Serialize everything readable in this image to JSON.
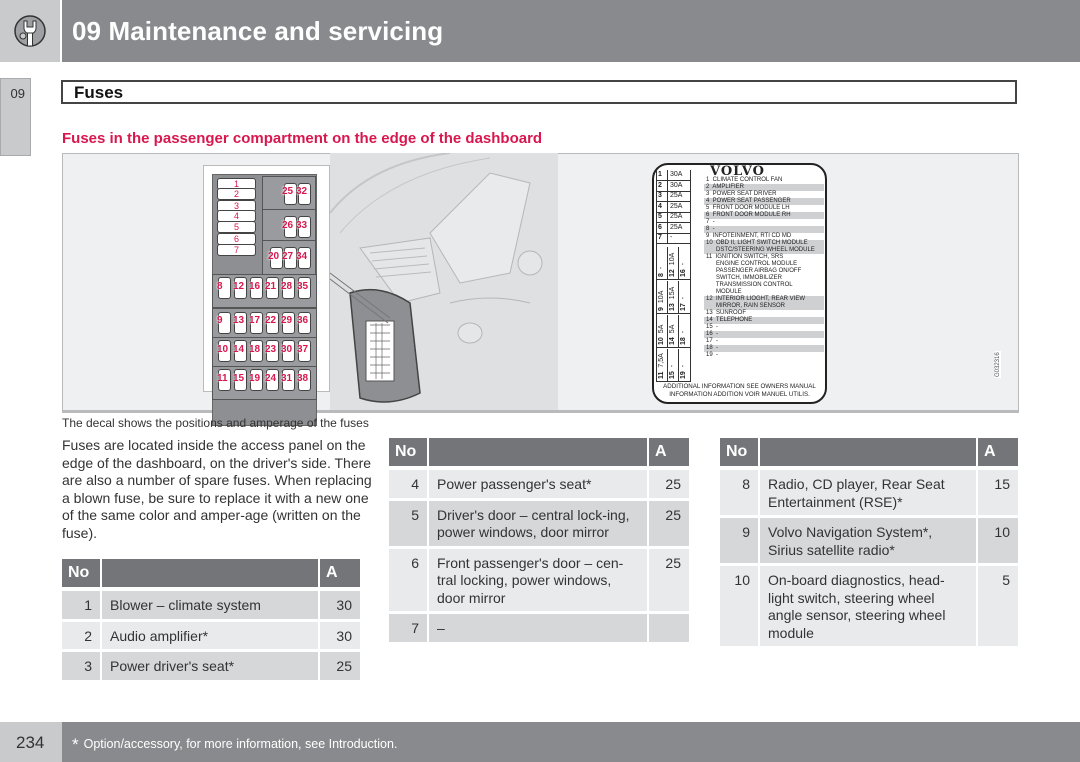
{
  "header": {
    "chapter_title": "09 Maintenance and servicing",
    "icon": "wrench-icon"
  },
  "side_tab": {
    "label": "09"
  },
  "section": {
    "title": "Fuses"
  },
  "subheading": "Fuses in the passenger compartment on the edge of the dashboard",
  "figure": {
    "caption": "The decal shows the positions and amperage of the fuses",
    "code": "G032316",
    "fusebox": {
      "wide_slots": [
        "1",
        "2",
        "3",
        "4",
        "5",
        "6",
        "7"
      ],
      "upper_panels": [
        [
          "25",
          "32"
        ],
        [
          "26",
          "33"
        ],
        [
          "20",
          "27",
          "34"
        ]
      ],
      "rows": [
        [
          "8",
          "12",
          "16",
          "21",
          "28",
          "35"
        ],
        [
          "9",
          "13",
          "17",
          "22",
          "29",
          "36"
        ],
        [
          "10",
          "14",
          "18",
          "23",
          "30",
          "37"
        ],
        [
          "11",
          "15",
          "19",
          "24",
          "31",
          "38"
        ]
      ]
    },
    "decal": {
      "logo": "VOLVO",
      "left_grid": [
        {
          "no": "1",
          "amp": "30A"
        },
        {
          "no": "2",
          "amp": "30A"
        },
        {
          "no": "3",
          "amp": "25A"
        },
        {
          "no": "4",
          "amp": "25A"
        },
        {
          "no": "5",
          "amp": "25A"
        },
        {
          "no": "6",
          "amp": "25A"
        },
        {
          "no": "7",
          "amp": "-"
        }
      ],
      "vertical_grid": [
        [
          {
            "no": "8",
            "amp": "-"
          },
          {
            "no": "12",
            "amp": "10A"
          },
          {
            "no": "16",
            "amp": "-"
          }
        ],
        [
          {
            "no": "9",
            "amp": "10A"
          },
          {
            "no": "13",
            "amp": "15A"
          },
          {
            "no": "17",
            "amp": "-"
          }
        ],
        [
          {
            "no": "10",
            "amp": "5A"
          },
          {
            "no": "14",
            "amp": "5A"
          },
          {
            "no": "18",
            "amp": "-"
          }
        ],
        [
          {
            "no": "11",
            "amp": "7,5A"
          },
          {
            "no": "15",
            "amp": "-"
          },
          {
            "no": "19",
            "amp": "-"
          }
        ]
      ],
      "list": [
        {
          "text": "1  CLIMATE CONTROL FAN",
          "shade": false
        },
        {
          "text": "2  AMPLIFIER",
          "shade": true
        },
        {
          "text": "3  POWER SEAT DRIVER",
          "shade": false
        },
        {
          "text": "4  POWER SEAT PASSENGER",
          "shade": true
        },
        {
          "text": "5  FRONT DOOR MODULE LH",
          "shade": false
        },
        {
          "text": "6  FRONT DOOR MODULE RH",
          "shade": true
        },
        {
          "text": "7  -",
          "shade": false
        },
        {
          "text": "8  -",
          "shade": true
        },
        {
          "text": "9  INFOTEINMENT, RTI CD MD",
          "shade": false
        },
        {
          "text": "10  OBD II, LIGHT SWITCH MODULE",
          "shade": true
        },
        {
          "text": "      DSTC/STEERING WHEEL MODULE",
          "shade": true
        },
        {
          "text": "11  IGNITION SWITCH, SRS",
          "shade": false
        },
        {
          "text": "      ENGINE CONTROL MODULE",
          "shade": false
        },
        {
          "text": "      PASSENGER AIRBAG ON/OFF",
          "shade": false
        },
        {
          "text": "      SWITCH, IMMOBILIZER",
          "shade": false
        },
        {
          "text": "      TRANSMISSION CONTROL",
          "shade": false
        },
        {
          "text": "      MODULE",
          "shade": false
        },
        {
          "text": "12  INTERIOR LIOGHT, REAR VIEW",
          "shade": true
        },
        {
          "text": "      MIRROR, RAIN SENSOR",
          "shade": true
        },
        {
          "text": "13  SUNROOF",
          "shade": false
        },
        {
          "text": "14  TELEPHONE",
          "shade": true
        },
        {
          "text": "15  -",
          "shade": false
        },
        {
          "text": "16  -",
          "shade": true
        },
        {
          "text": "17  -",
          "shade": false
        },
        {
          "text": "18  -",
          "shade": true
        },
        {
          "text": "19  -",
          "shade": false
        }
      ],
      "footer_line1": "ADDITIONAL INFORMATION SEE OWNERS MANUAL",
      "footer_line2": "INFORMATION ADDITION VOIR MANUEL UTILIS."
    }
  },
  "intro_text": "Fuses are located inside the access panel on the edge of the dashboard, on the driver's side. There are also a number of spare fuses. When replacing a blown fuse, be sure to replace it with a new one of the same color and amper-age (written on the fuse).",
  "table_headers": {
    "no": "No",
    "desc": "",
    "amp": "A"
  },
  "tables": [
    {
      "rows": [
        {
          "no": "1",
          "desc": "Blower – climate system",
          "amp": "30"
        },
        {
          "no": "2",
          "desc": "Audio amplifier*",
          "amp": "30"
        },
        {
          "no": "3",
          "desc": "Power driver's seat*",
          "amp": "25"
        }
      ]
    },
    {
      "rows": [
        {
          "no": "4",
          "desc": "Power passenger's seat*",
          "amp": "25"
        },
        {
          "no": "5",
          "desc": "Driver's door – central lock-ing, power windows, door mirror",
          "amp": "25"
        },
        {
          "no": "6",
          "desc": "Front passenger's door – cen-tral locking, power windows, door mirror",
          "amp": "25"
        },
        {
          "no": "7",
          "desc": "–",
          "amp": ""
        }
      ]
    },
    {
      "rows": [
        {
          "no": "8",
          "desc": "Radio, CD player, Rear Seat Entertainment (RSE)*",
          "amp": "15"
        },
        {
          "no": "9",
          "desc": "Volvo Navigation System*, Sirius satellite radio*",
          "amp": "10"
        },
        {
          "no": "10",
          "desc": "On-board diagnostics, head-light switch, steering wheel angle sensor, steering wheel module",
          "amp": "5"
        }
      ]
    }
  ],
  "footer": {
    "page_number": "234",
    "star": "*",
    "note": "Option/accessory, for more information, see Introduction."
  },
  "colors": {
    "accent_red": "#d8174e",
    "header_gray": "#898a8d",
    "table_header": "#747578"
  }
}
